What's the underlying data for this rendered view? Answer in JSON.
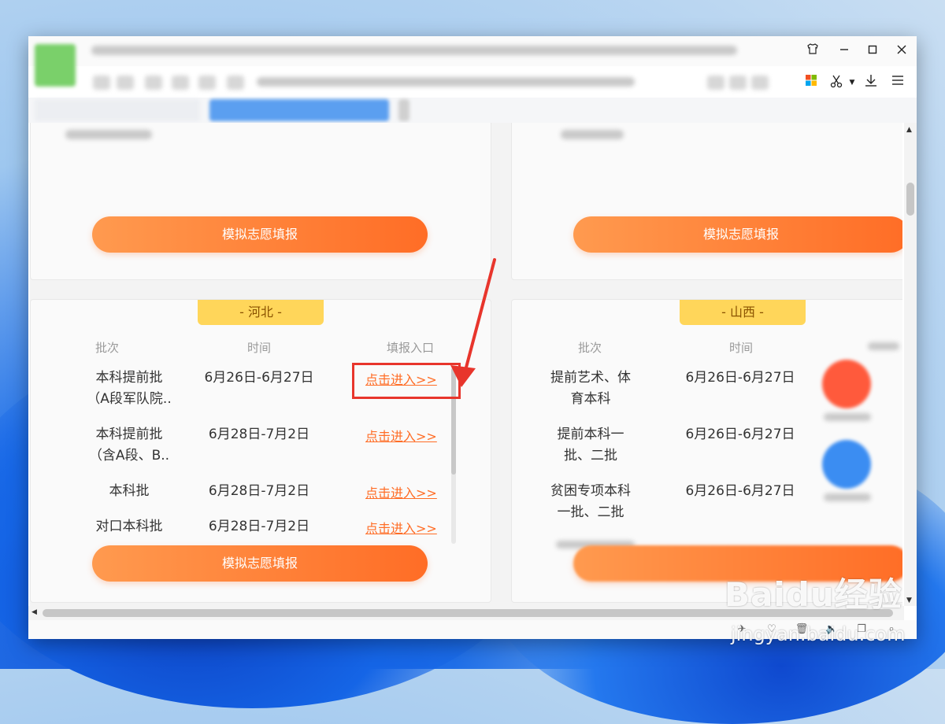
{
  "browser": {
    "tab_title": "",
    "toolbar_icons": [
      "shirt-icon",
      "minimize-icon",
      "maximize-icon",
      "close-icon"
    ],
    "right_tools": [
      "apps-icon",
      "scissors-icon",
      "download-icon",
      "menu-icon"
    ]
  },
  "cards": {
    "top_left_button": "模拟志愿填报",
    "top_right_button": "模拟志愿填报",
    "hebei": {
      "province": "- 河北 -",
      "headers": [
        "批次",
        "时间",
        "填报入口"
      ],
      "rows": [
        {
          "batch": "本科提前批\n（A段军队院..",
          "time": "6月26日-6月27日",
          "link": "点击进入>>"
        },
        {
          "batch": "本科提前批\n（含A段、B..",
          "time": "6月28日-7月2日",
          "link": "点击进入>>"
        },
        {
          "batch": "本科批",
          "time": "6月28日-7月2日",
          "link": "点击进入>>"
        },
        {
          "batch": "对口本科批",
          "time": "6月28日-7月2日",
          "link": "点击进入>>"
        }
      ],
      "button": "模拟志愿填报"
    },
    "shanxi": {
      "province": "- 山西 -",
      "headers": [
        "批次",
        "时间"
      ],
      "rows": [
        {
          "batch": "提前艺术、体\n育本科",
          "time": "6月26日-6月27日"
        },
        {
          "batch": "提前本科一\n批、二批",
          "time": "6月26日-6月27日"
        },
        {
          "batch": "贫困专项本科\n一批、二批",
          "time": "6月26日-6月27日"
        }
      ]
    }
  },
  "watermark": {
    "brand": "Baidu经验",
    "url": "jingyan.baidu.com"
  },
  "colors": {
    "accent_orange": "#ff6d26",
    "tag_yellow": "#ffd65a",
    "highlight_red": "#e8352c"
  }
}
